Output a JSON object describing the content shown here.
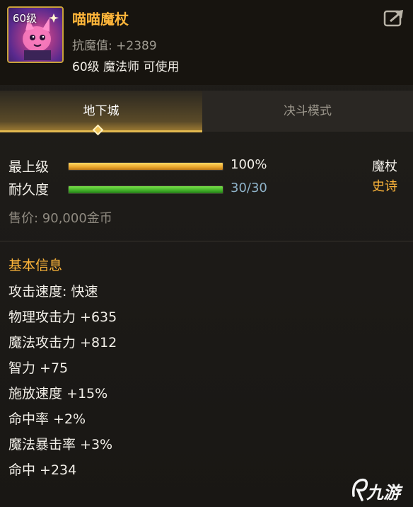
{
  "item": {
    "level_tag": "60级",
    "name": "喵喵魔杖",
    "magic_resist": "抗魔值: +2389",
    "requirement": "60级 魔法师 可使用"
  },
  "tabs": [
    {
      "label": "地下城",
      "active": true
    },
    {
      "label": "决斗模式",
      "active": false
    }
  ],
  "bars": {
    "grade": {
      "label": "最上级",
      "value_text": "100%",
      "fraction": 1.0,
      "color": "#e9a52a"
    },
    "durability": {
      "label": "耐久度",
      "value_text": "30/30",
      "fraction": 1.0,
      "color": "#3fae27"
    }
  },
  "weapon_type": "魔杖",
  "rarity": {
    "label": "史诗",
    "color": "#ffb63a"
  },
  "price": "售价: 90,000金币",
  "basic_info": {
    "title": "基本信息",
    "attributes": [
      "攻击速度: 快速",
      "物理攻击力 +635",
      "魔法攻击力 +812",
      "智力 +75",
      "施放速度 +15%",
      "命中率 +2%",
      "魔法暴击率 +3%",
      "命中 +234"
    ]
  },
  "watermark": {
    "text": "九游",
    "icon": "jiuyou-logo-icon"
  },
  "share_icon": "share-icon"
}
